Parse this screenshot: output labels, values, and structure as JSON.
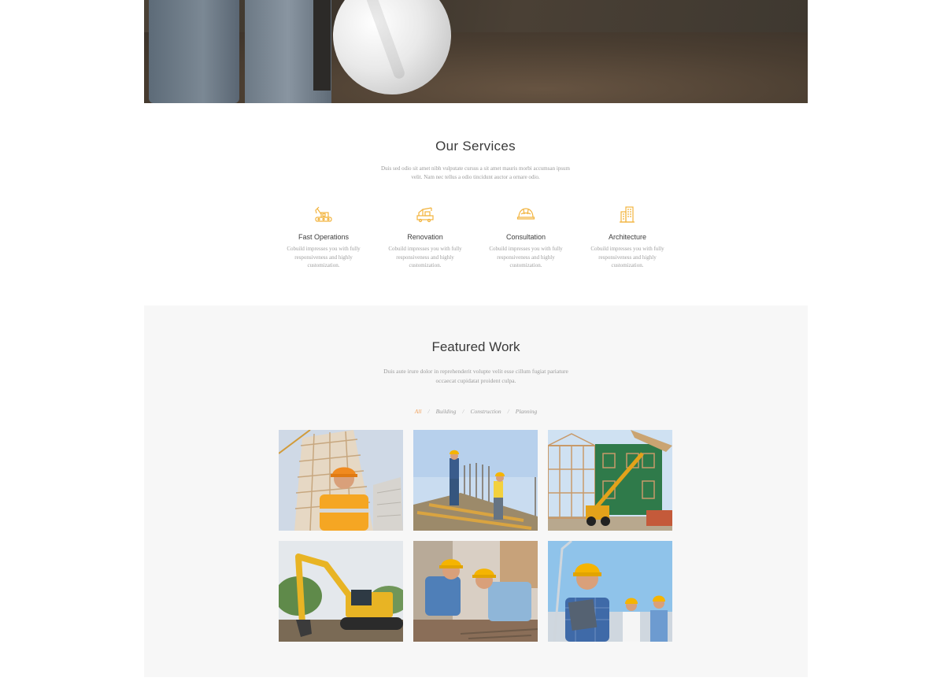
{
  "services": {
    "title": "Our Services",
    "subtitle": "Duis sed odio sit amet nibh vulputate cursus a sit amet mauris morbi accumsan ipsum velit. Nam nec tellus a odio tincidunt auctor a ornare odio.",
    "items": [
      {
        "name": "Fast Operations",
        "icon": "excavator-icon",
        "desc": "Cobuild impresses you with fully responsiveness and highly customization."
      },
      {
        "name": "Renovation",
        "icon": "crane-truck-icon",
        "desc": "Cobuild impresses you with fully responsiveness and highly customization."
      },
      {
        "name": "Consultation",
        "icon": "hard-hat-icon",
        "desc": "Cobuild impresses you with fully responsiveness and highly customization."
      },
      {
        "name": "Architecture",
        "icon": "buildings-icon",
        "desc": "Cobuild impresses you with fully responsiveness and highly customization."
      }
    ]
  },
  "featured": {
    "title": "Featured Work",
    "subtitle": "Duis aute irure dolor in reprehenderit volupte velit esse cillum fugiat pariature occaecat cupidatat proident culpa.",
    "filters": [
      "All",
      "Building",
      "Construction",
      "Planning"
    ],
    "active_filter": "All",
    "gallery": [
      {
        "subject": "worker-tower-photo"
      },
      {
        "subject": "workers-rebar-photo"
      },
      {
        "subject": "house-frame-photo"
      },
      {
        "subject": "excavator-photo"
      },
      {
        "subject": "workers-bricks-photo"
      },
      {
        "subject": "engineer-tablet-photo"
      }
    ]
  },
  "colors": {
    "accent": "#f0a05a",
    "icon": "#f2b33d",
    "section_bg": "#f7f7f7"
  }
}
